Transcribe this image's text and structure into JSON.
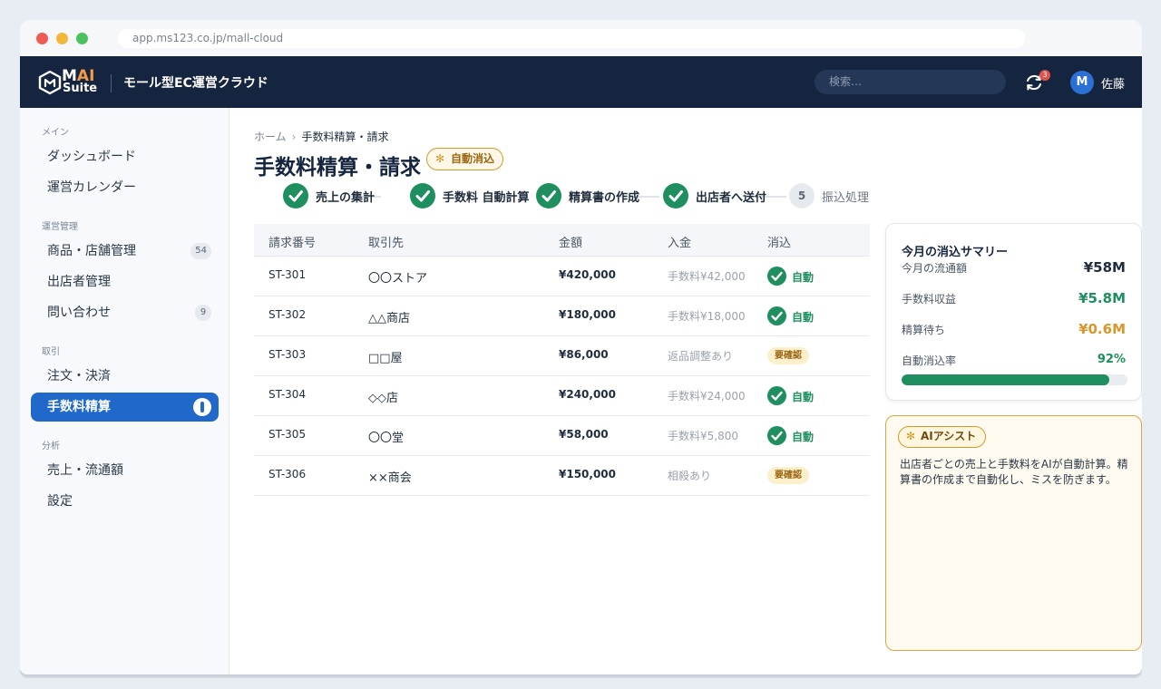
{
  "browser": {
    "url": "app.ms123.co.jp/mall-cloud"
  },
  "header": {
    "logo_main": "M",
    "logo_ai": "AI",
    "logo_sub": "Suite",
    "app_title": "モール型EC運営クラウド",
    "search_placeholder": "検索…",
    "notification_count": "3",
    "avatar_initial": "M",
    "user_name": "佐藤"
  },
  "sidebar": {
    "sections": [
      {
        "title": "メイン",
        "items": [
          {
            "label": "ダッシュボード"
          },
          {
            "label": "運営カレンダー"
          }
        ]
      },
      {
        "title": "運営管理",
        "items": [
          {
            "label": "商品・店舗管理",
            "count": "54"
          },
          {
            "label": "出店者管理"
          },
          {
            "label": "問い合わせ",
            "count": "9"
          }
        ]
      },
      {
        "title": "取引",
        "items": [
          {
            "label": "注文・決済"
          },
          {
            "label": "手数料精算",
            "active": true
          }
        ]
      },
      {
        "title": "分析",
        "items": [
          {
            "label": "売上・流通額"
          },
          {
            "label": "設定"
          }
        ]
      }
    ]
  },
  "breadcrumb": {
    "home": "ホーム",
    "separator": "›",
    "current": "手数料精算・請求"
  },
  "page": {
    "title": "手数料精算・請求",
    "badge": "自動消込"
  },
  "steps": [
    {
      "label": "売上の集計",
      "done": true
    },
    {
      "label": "手数料 自動計算",
      "done": true
    },
    {
      "label": "精算書の作成",
      "done": true
    },
    {
      "label": "出店者へ送付",
      "done": true
    },
    {
      "number": "5",
      "label": "振込処理",
      "done": false
    }
  ],
  "table": {
    "headers": [
      "請求番号",
      "取引先",
      "金額",
      "入金",
      "消込"
    ],
    "rows": [
      {
        "id": "ST-301",
        "partner": "〇〇ストア",
        "amount": "¥420,000",
        "payment": "手数料¥42,000",
        "status": "自動",
        "status_type": "auto"
      },
      {
        "id": "ST-302",
        "partner": "△△商店",
        "amount": "¥180,000",
        "payment": "手数料¥18,000",
        "status": "自動",
        "status_type": "auto"
      },
      {
        "id": "ST-303",
        "partner": "□□屋",
        "amount": "¥86,000",
        "payment": "返品調整あり",
        "status": "要確認",
        "status_type": "confirm"
      },
      {
        "id": "ST-304",
        "partner": "◇◇店",
        "amount": "¥240,000",
        "payment": "手数料¥24,000",
        "status": "自動",
        "status_type": "auto"
      },
      {
        "id": "ST-305",
        "partner": "〇〇堂",
        "amount": "¥58,000",
        "payment": "手数料¥5,800",
        "status": "自動",
        "status_type": "auto"
      },
      {
        "id": "ST-306",
        "partner": "××商会",
        "amount": "¥150,000",
        "payment": "相殺あり",
        "status": "要確認",
        "status_type": "confirm"
      }
    ]
  },
  "summary": {
    "title": "今月の消込サマリー",
    "items": [
      {
        "label": "今月の流通額",
        "value": "¥58M",
        "color": "#1f2d3d"
      },
      {
        "label": "手数料収益",
        "value": "¥5.8M",
        "color": "#1f8f5f"
      },
      {
        "label": "精算待ち",
        "value": "¥0.6M",
        "color": "#d9962a"
      },
      {
        "label": "自動消込率",
        "value": "92%",
        "color": "#1f8f5f"
      }
    ],
    "auto_rate_fraction": 0.92
  },
  "assist": {
    "title": "AIアシスト",
    "text": "出店者ごとの売上と手数料をAIが自動計算。精算書の作成まで自動化し、ミスを防ぎます。"
  },
  "colors": {
    "topbar": "#15253f",
    "accent": "#2068c9",
    "success": "#1f8f5f",
    "warning": "#d9962a",
    "notification": "#e2524c"
  }
}
